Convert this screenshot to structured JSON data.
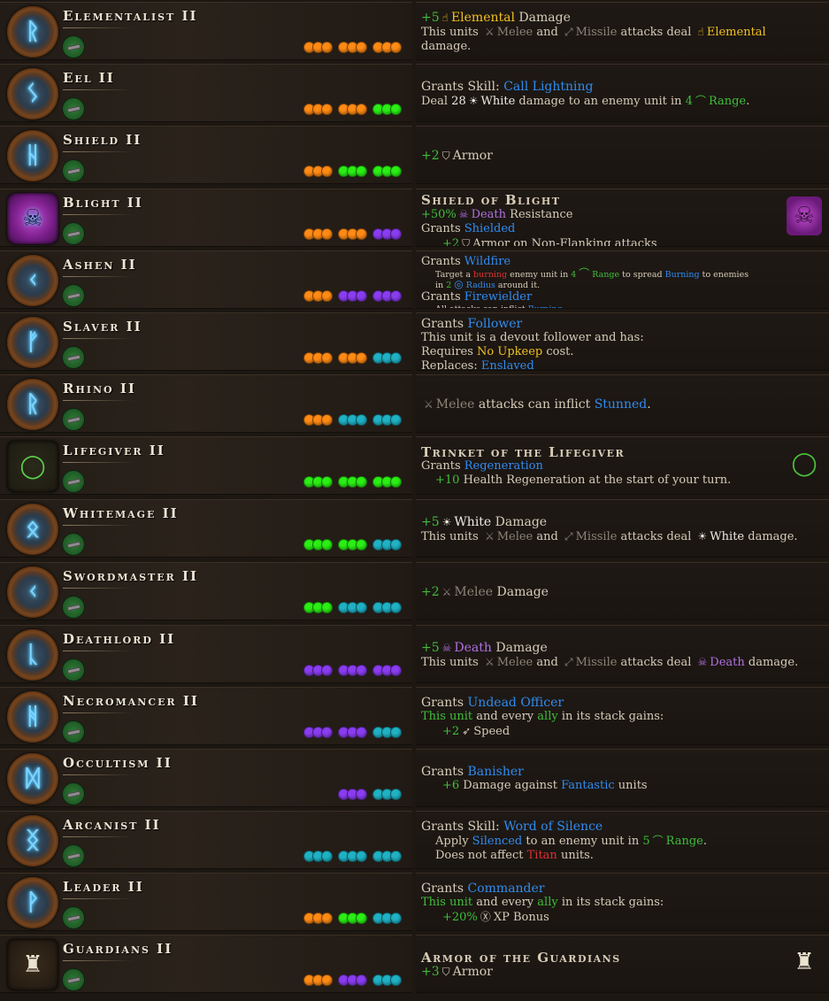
{
  "colors": {
    "orange": "#ff8a14",
    "green": "#2aee14",
    "purple": "#8a3cf0",
    "teal": "#1fb1c4",
    "highlight_green": "#3fbf3a",
    "highlight_blue": "#2f8cf0",
    "highlight_yellow": "#f0c020",
    "highlight_purple": "#b070e0",
    "highlight_red": "#e03030"
  },
  "rows": [
    {
      "name": "Elementalist II",
      "icon": "rune-icon",
      "glyph": "ᚱ",
      "dots": [
        [
          "orange",
          3
        ],
        [
          "orange",
          3
        ],
        [
          "orange",
          3
        ]
      ],
      "desc": [
        {
          "cls": "big",
          "parts": [
            [
              "+5",
              "hl-green"
            ],
            [
              "☝",
              "ic hl-yellow"
            ],
            [
              "Elemental",
              "hl-yellow"
            ],
            [
              " Damage",
              ""
            ]
          ]
        },
        {
          "parts": [
            [
              "This units ",
              ""
            ],
            [
              "⚔",
              "ic hl-gray"
            ],
            [
              "Melee",
              "hl-gray"
            ],
            [
              " and ",
              ""
            ],
            [
              "⤢",
              "ic hl-gray"
            ],
            [
              "Missile",
              "hl-gray"
            ],
            [
              " attacks deal ",
              ""
            ],
            [
              "☝",
              "ic hl-yellow"
            ],
            [
              "Elemental",
              "hl-yellow"
            ]
          ]
        },
        {
          "parts": [
            [
              "damage.",
              ""
            ]
          ]
        }
      ]
    },
    {
      "name": "Eel II",
      "icon": "rune-icon",
      "glyph": "ᛊ",
      "dots": [
        [
          "orange",
          3
        ],
        [
          "orange",
          3
        ],
        [
          "green",
          3
        ]
      ],
      "desc": [
        {
          "cls": "big",
          "parts": [
            [
              "Grants Skill: ",
              ""
            ],
            [
              "Call Lightning",
              "hl-blue"
            ]
          ]
        },
        {
          "parts": [
            [
              "Deal ",
              ""
            ],
            [
              "28",
              "hl-white"
            ],
            [
              "☀",
              "ic hl-white"
            ],
            [
              "White",
              "hl-white"
            ],
            [
              " damage to an enemy unit in ",
              ""
            ],
            [
              "4",
              "hl-green"
            ],
            [
              "⌒",
              "ic hl-green"
            ],
            [
              "Range",
              "hl-green"
            ],
            [
              ".",
              ""
            ]
          ]
        }
      ]
    },
    {
      "name": "Shield II",
      "icon": "rune-icon",
      "glyph": "ᚺ",
      "dots": [
        [
          "orange",
          3
        ],
        [
          "green",
          3
        ],
        [
          "green",
          3
        ]
      ],
      "desc": [
        {
          "cls": "big",
          "parts": [
            [
              "+2",
              "hl-green"
            ],
            [
              "⛉",
              "ic"
            ],
            [
              "Armor",
              ""
            ]
          ]
        }
      ]
    },
    {
      "name": "Blight II",
      "icon": "blight-shield-icon",
      "glyph": "☠",
      "item": "blight",
      "dots": [
        [
          "orange",
          3
        ],
        [
          "orange",
          3
        ],
        [
          "purple",
          3
        ]
      ],
      "desc_top": true,
      "item_icon": "blight-shield-icon",
      "item_glyph": "☠",
      "desc": [
        {
          "cls": "title",
          "parts": [
            [
              "Shield of Blight",
              ""
            ]
          ]
        },
        {
          "parts": [
            [
              "+50%",
              "hl-green"
            ],
            [
              "☠",
              "ic hl-purple"
            ],
            [
              "Death",
              "hl-purple"
            ],
            [
              " Resistance",
              ""
            ]
          ]
        },
        {
          "parts": [
            [
              "Grants ",
              ""
            ],
            [
              "Shielded",
              "hl-blue"
            ]
          ]
        },
        {
          "ind": "ind2",
          "parts": [
            [
              "+2",
              "hl-green"
            ],
            [
              "⛉",
              "ic"
            ],
            [
              "Armor on Non-Flanking attacks",
              ""
            ]
          ]
        }
      ]
    },
    {
      "name": "Ashen II",
      "icon": "rune-icon",
      "glyph": "ᚲ",
      "dots": [
        [
          "orange",
          3
        ],
        [
          "purple",
          3
        ],
        [
          "purple",
          3
        ]
      ],
      "desc_top": true,
      "desc": [
        {
          "parts": [
            [
              "Grants ",
              ""
            ],
            [
              "Wildfire",
              "hl-blue"
            ]
          ]
        },
        {
          "cls": "small",
          "ind": "ind1",
          "parts": [
            [
              "Target a ",
              ""
            ],
            [
              "burning",
              "hl-red"
            ],
            [
              " enemy unit in ",
              ""
            ],
            [
              "4",
              "hl-green"
            ],
            [
              "⌒",
              "ic hl-green"
            ],
            [
              "Range",
              "hl-green"
            ],
            [
              " to spread ",
              ""
            ],
            [
              "Burning",
              "hl-blue"
            ],
            [
              " to enemies",
              ""
            ]
          ]
        },
        {
          "cls": "small",
          "ind": "ind1",
          "parts": [
            [
              "in ",
              ""
            ],
            [
              "2",
              "hl-green"
            ],
            [
              "◎",
              "ic hl-blue"
            ],
            [
              "Radius",
              "hl-blue"
            ],
            [
              " around it.",
              ""
            ]
          ]
        },
        {
          "parts": [
            [
              "Grants ",
              ""
            ],
            [
              "Firewielder",
              "hl-blue"
            ]
          ]
        },
        {
          "cls": "small",
          "ind": "ind1",
          "parts": [
            [
              "All attacks can inflict ",
              ""
            ],
            [
              "Burning",
              "hl-blue"
            ],
            [
              ".",
              ""
            ]
          ]
        }
      ]
    },
    {
      "name": "Slaver II",
      "icon": "rune-icon",
      "glyph": "ᚠ",
      "dots": [
        [
          "orange",
          3
        ],
        [
          "orange",
          3
        ],
        [
          "teal",
          3
        ]
      ],
      "desc_top": true,
      "desc": [
        {
          "cls": "big",
          "parts": [
            [
              "Grants ",
              ""
            ],
            [
              "Follower",
              "hl-blue"
            ]
          ]
        },
        {
          "parts": [
            [
              "This unit is a devout follower and has:",
              ""
            ]
          ]
        },
        {
          "parts": [
            [
              "Requires ",
              ""
            ],
            [
              "No Upkeep",
              "hl-yellow"
            ],
            [
              " cost.",
              ""
            ]
          ]
        },
        {
          "parts": [
            [
              "Replaces: ",
              ""
            ],
            [
              "Enslaved",
              "hl-blue"
            ]
          ]
        }
      ]
    },
    {
      "name": "Rhino II",
      "icon": "rune-icon",
      "glyph": "ᚱ",
      "dots": [
        [
          "orange",
          3
        ],
        [
          "teal",
          3
        ],
        [
          "teal",
          3
        ]
      ],
      "desc": [
        {
          "cls": "big",
          "parts": [
            [
              "⚔",
              "ic hl-gray"
            ],
            [
              "Melee",
              "hl-gray"
            ],
            [
              " attacks can inflict ",
              ""
            ],
            [
              "Stunned",
              "hl-blue"
            ],
            [
              ".",
              ""
            ]
          ]
        }
      ]
    },
    {
      "name": "Lifegiver II",
      "icon": "ring-icon",
      "glyph": "◯",
      "item": "ring",
      "dots": [
        [
          "green",
          3
        ],
        [
          "green",
          3
        ],
        [
          "green",
          3
        ]
      ],
      "item_icon": "ring-icon",
      "item_glyph": "◯",
      "desc": [
        {
          "cls": "title",
          "parts": [
            [
              "Trinket of the Lifegiver",
              ""
            ]
          ]
        },
        {
          "parts": [
            [
              "Grants ",
              ""
            ],
            [
              "Regeneration",
              "hl-blue"
            ]
          ]
        },
        {
          "ind": "ind1",
          "parts": [
            [
              "+10",
              "hl-green"
            ],
            [
              " Health Regeneration at the start of your turn.",
              ""
            ]
          ]
        }
      ]
    },
    {
      "name": "Whitemage II",
      "icon": "rune-icon",
      "glyph": "ᛟ",
      "dots": [
        [
          "green",
          3
        ],
        [
          "green",
          3
        ],
        [
          "teal",
          3
        ]
      ],
      "desc": [
        {
          "cls": "big",
          "parts": [
            [
              "+5",
              "hl-green"
            ],
            [
              "☀",
              "ic hl-white"
            ],
            [
              "White",
              "hl-white"
            ],
            [
              " Damage",
              ""
            ]
          ]
        },
        {
          "parts": [
            [
              "This units ",
              ""
            ],
            [
              "⚔",
              "ic hl-gray"
            ],
            [
              "Melee",
              "hl-gray"
            ],
            [
              " and ",
              ""
            ],
            [
              "⤢",
              "ic hl-gray"
            ],
            [
              "Missile",
              "hl-gray"
            ],
            [
              " attacks deal ",
              ""
            ],
            [
              "☀",
              "ic hl-white"
            ],
            [
              "White",
              "hl-white"
            ],
            [
              " damage.",
              ""
            ]
          ]
        }
      ]
    },
    {
      "name": "Swordmaster II",
      "icon": "rune-icon",
      "glyph": "ᚲ",
      "dots": [
        [
          "green",
          3
        ],
        [
          "teal",
          3
        ],
        [
          "teal",
          3
        ]
      ],
      "desc": [
        {
          "cls": "big",
          "parts": [
            [
              "+2",
              "hl-green"
            ],
            [
              "⚔",
              "ic hl-gray"
            ],
            [
              "Melee",
              "hl-gray"
            ],
            [
              " Damage",
              ""
            ]
          ]
        }
      ]
    },
    {
      "name": "Deathlord II",
      "icon": "rune-icon",
      "glyph": "ᚳ",
      "dots": [
        [
          "purple",
          3
        ],
        [
          "purple",
          3
        ],
        [
          "purple",
          3
        ]
      ],
      "desc": [
        {
          "cls": "big",
          "parts": [
            [
              "+5",
              "hl-green"
            ],
            [
              "☠",
              "ic hl-purple"
            ],
            [
              "Death",
              "hl-purple"
            ],
            [
              " Damage",
              ""
            ]
          ]
        },
        {
          "parts": [
            [
              "This units ",
              ""
            ],
            [
              "⚔",
              "ic hl-gray"
            ],
            [
              "Melee",
              "hl-gray"
            ],
            [
              " and ",
              ""
            ],
            [
              "⤢",
              "ic hl-gray"
            ],
            [
              "Missile",
              "hl-gray"
            ],
            [
              " attacks deal ",
              ""
            ],
            [
              "☠",
              "ic hl-purple"
            ],
            [
              "Death",
              "hl-purple"
            ],
            [
              " damage.",
              ""
            ]
          ]
        }
      ]
    },
    {
      "name": "Necromancer II",
      "icon": "rune-icon",
      "glyph": "ᚻ",
      "dots": [
        [
          "purple",
          3
        ],
        [
          "purple",
          3
        ],
        [
          "teal",
          3
        ]
      ],
      "desc": [
        {
          "cls": "big",
          "parts": [
            [
              "Grants ",
              ""
            ],
            [
              "Undead Officer",
              "hl-blue"
            ]
          ]
        },
        {
          "parts": [
            [
              "This unit",
              "hl-green"
            ],
            [
              " and every ",
              ""
            ],
            [
              "ally",
              "hl-green"
            ],
            [
              " in its stack gains:",
              ""
            ]
          ]
        },
        {
          "ind": "ind2",
          "parts": [
            [
              "+2",
              "hl-green"
            ],
            [
              "➶",
              "ic"
            ],
            [
              "Speed",
              ""
            ]
          ]
        }
      ]
    },
    {
      "name": "Occultism II",
      "icon": "rune-icon",
      "glyph": "ᛞ",
      "dots": [
        [
          "purple",
          3
        ],
        [
          "teal",
          3
        ]
      ],
      "desc": [
        {
          "cls": "big",
          "parts": [
            [
              "Grants ",
              ""
            ],
            [
              "Banisher",
              "hl-blue"
            ]
          ]
        },
        {
          "ind": "ind2",
          "parts": [
            [
              "+6",
              "hl-green"
            ],
            [
              " Damage against ",
              ""
            ],
            [
              "Fantastic",
              "hl-blue"
            ],
            [
              " units",
              ""
            ]
          ]
        }
      ]
    },
    {
      "name": "Arcanist II",
      "icon": "rune-icon",
      "glyph": "ᛝ",
      "dots": [
        [
          "teal",
          3
        ],
        [
          "teal",
          3
        ],
        [
          "teal",
          3
        ]
      ],
      "desc": [
        {
          "cls": "big",
          "parts": [
            [
              "Grants Skill: ",
              ""
            ],
            [
              "Word of Silence",
              "hl-blue"
            ]
          ]
        },
        {
          "ind": "ind1",
          "parts": [
            [
              "Apply ",
              ""
            ],
            [
              "Silenced",
              "hl-blue"
            ],
            [
              " to an enemy unit in ",
              ""
            ],
            [
              "5",
              "hl-green"
            ],
            [
              "⌒",
              "ic hl-green"
            ],
            [
              "Range",
              "hl-green"
            ],
            [
              ".",
              ""
            ]
          ]
        },
        {
          "ind": "ind1",
          "parts": [
            [
              "Does not affect ",
              ""
            ],
            [
              "Titan",
              "hl-red"
            ],
            [
              " units.",
              ""
            ]
          ]
        }
      ]
    },
    {
      "name": "Leader II",
      "icon": "rune-icon",
      "glyph": "ᚹ",
      "dots": [
        [
          "orange",
          3
        ],
        [
          "green",
          3
        ],
        [
          "teal",
          3
        ]
      ],
      "desc": [
        {
          "cls": "big",
          "parts": [
            [
              "Grants ",
              ""
            ],
            [
              "Commander",
              "hl-blue"
            ]
          ]
        },
        {
          "parts": [
            [
              "This unit",
              "hl-green"
            ],
            [
              " and every ",
              ""
            ],
            [
              "ally",
              "hl-green"
            ],
            [
              " in its stack gains:",
              ""
            ]
          ]
        },
        {
          "ind": "ind2",
          "parts": [
            [
              "+20%",
              "hl-green"
            ],
            [
              "Ⓧ",
              "ic"
            ],
            [
              "XP Bonus",
              ""
            ]
          ]
        }
      ]
    },
    {
      "name": "Guardians II",
      "icon": "armor-icon",
      "glyph": "♜",
      "item": "armor",
      "dots": [
        [
          "orange",
          3
        ],
        [
          "purple",
          3
        ],
        [
          "teal",
          3
        ]
      ],
      "item_icon": "armor-icon",
      "item_glyph": "♜",
      "desc": [
        {
          "cls": "title",
          "parts": [
            [
              "Armor of the Guardians",
              ""
            ]
          ]
        },
        {
          "cls": "big",
          "parts": [
            [
              "+3",
              "hl-green"
            ],
            [
              "⛉",
              "ic"
            ],
            [
              "Armor",
              ""
            ]
          ]
        }
      ]
    }
  ]
}
